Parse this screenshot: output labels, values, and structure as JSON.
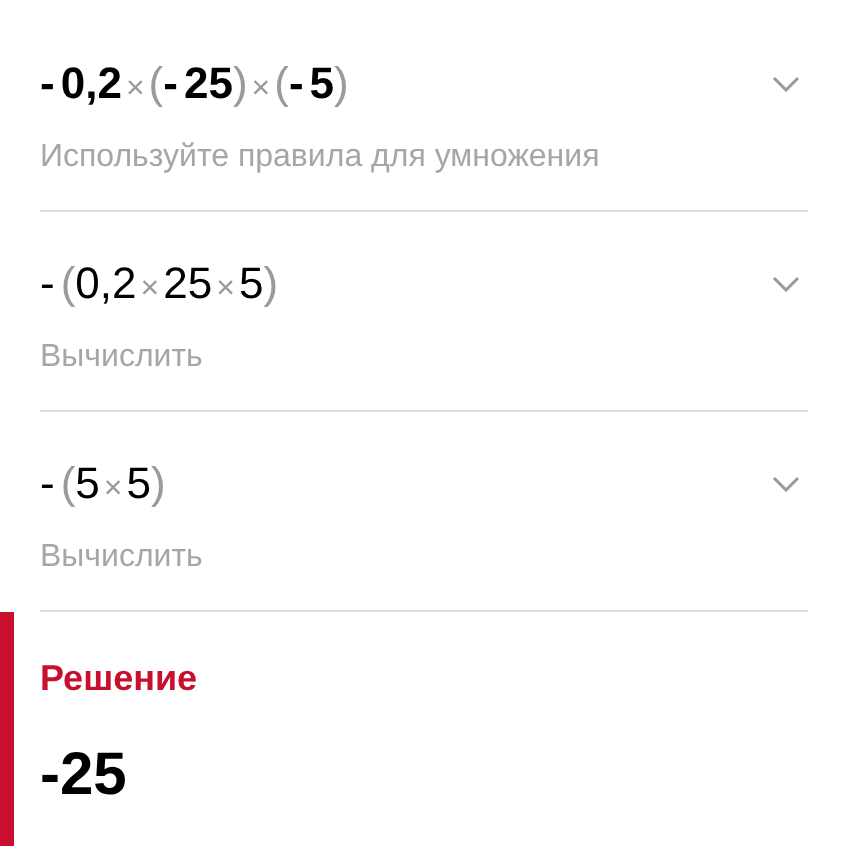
{
  "steps": [
    {
      "kind": "given",
      "expression": "-0,2×(-25)×(-5)",
      "hint": "Используйте правила для умножения"
    },
    {
      "kind": "step",
      "expression": "-(0,2×25×5)",
      "hint": "Вычислить"
    },
    {
      "kind": "step",
      "expression": "-(5×5)",
      "hint": "Вычислить"
    }
  ],
  "solution": {
    "title": "Решение",
    "answer": "-25"
  }
}
